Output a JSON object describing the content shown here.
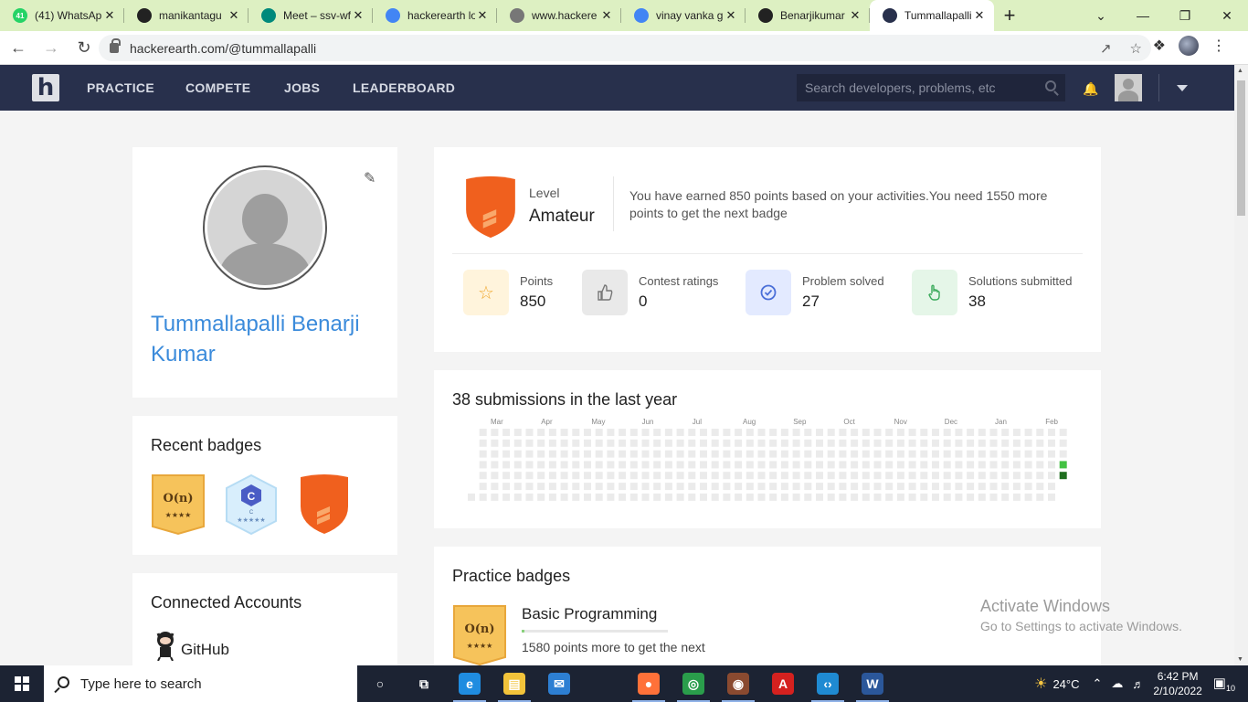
{
  "browser": {
    "tabs": [
      {
        "label": "(41) WhatsAp",
        "icon": "whatsapp-icon",
        "color": "#25d366",
        "badge": "41"
      },
      {
        "label": "manikantagu",
        "icon": "github-icon",
        "color": "#222222"
      },
      {
        "label": "Meet – ssv-wf",
        "icon": "meet-icon",
        "color": "#00897b"
      },
      {
        "label": "hackerearth lo",
        "icon": "google-icon",
        "color": "#4285f4"
      },
      {
        "label": "www.hackere",
        "icon": "globe-icon",
        "color": "#777777"
      },
      {
        "label": "vinay vanka g",
        "icon": "google-icon",
        "color": "#4285f4"
      },
      {
        "label": "Benarjikumar",
        "icon": "github-icon",
        "color": "#222222"
      },
      {
        "label": "Tummallapalli",
        "icon": "hackerearth-icon",
        "color": "#28304c"
      }
    ],
    "active_tab": 7,
    "url": "hackerearth.com/@tummallapalli"
  },
  "site": {
    "logo": "h",
    "nav": [
      "PRACTICE",
      "COMPETE",
      "JOBS",
      "LEADERBOARD"
    ],
    "search_placeholder": "Search developers, problems, etc"
  },
  "profile": {
    "name": "Tummallapalli Benarji Kumar",
    "recent_badges_title": "Recent badges",
    "badges": [
      {
        "type": "gold-complexity",
        "text": "O(n)",
        "stars": "★★★★"
      },
      {
        "type": "blue-c",
        "text": "C",
        "sub": "C",
        "stars": "★★★★★"
      },
      {
        "type": "orange-shield"
      }
    ],
    "connected_title": "Connected Accounts",
    "accounts": [
      {
        "name": "GitHub",
        "icon": "github-octocat-icon"
      }
    ]
  },
  "level": {
    "label": "Level",
    "name": "Amateur",
    "message": "You have earned 850 points based on your activities.You need 1550 more points to get the next badge",
    "stats": [
      {
        "label": "Points",
        "value": "850",
        "icon": "star-icon",
        "bg": "#fff4dc",
        "fg": "#f0a830"
      },
      {
        "label": "Contest ratings",
        "value": "0",
        "icon": "thumbs-up-icon",
        "bg": "#e9e9e9",
        "fg": "#777777"
      },
      {
        "label": "Problem solved",
        "value": "27",
        "icon": "check-circle-icon",
        "bg": "#e3eaff",
        "fg": "#4a6fd8"
      },
      {
        "label": "Solutions submitted",
        "value": "38",
        "icon": "hand-pointer-icon",
        "bg": "#e5f6e8",
        "fg": "#3aaa5a"
      }
    ]
  },
  "submissions": {
    "title": "38 submissions in the last year",
    "months": [
      "Mar",
      "Apr",
      "May",
      "Jun",
      "Jul",
      "Aug",
      "Sep",
      "Oct",
      "Nov",
      "Dec",
      "Jan",
      "Feb"
    ],
    "active_cells": [
      {
        "week": 51,
        "day": 3,
        "level": 1
      },
      {
        "week": 51,
        "day": 4,
        "level": 2
      }
    ],
    "colors": {
      "empty": "#ebebeb",
      "level1": "#43c243",
      "level2": "#1f6e1f"
    }
  },
  "practice": {
    "title": "Practice badges",
    "badge_name": "Basic Programming",
    "badge_text": "O(n)",
    "badge_stars": "★★★★",
    "progress_fraction": 0.02,
    "points_text": "1580 points more to get the next"
  },
  "watermark": {
    "line1": "Activate Windows",
    "line2": "Go to Settings to activate Windows."
  },
  "taskbar": {
    "search_placeholder": "Type here to search",
    "apps": [
      {
        "name": "cortana",
        "icon": "circle-icon",
        "color": "#ffffff"
      },
      {
        "name": "task-view",
        "icon": "task-view-icon",
        "color": "#ffffff"
      },
      {
        "name": "edge",
        "icon": "edge-icon",
        "color": "#1f8ce0"
      },
      {
        "name": "file-explorer",
        "icon": "folder-icon",
        "color": "#f2c33a"
      },
      {
        "name": "mail",
        "icon": "mail-icon",
        "color": "#2d7fd3"
      },
      {
        "name": "firefox",
        "icon": "firefox-icon",
        "color": "#ff7139"
      },
      {
        "name": "chrome",
        "icon": "chrome-icon",
        "color": "#2a9d4b"
      },
      {
        "name": "chrome-profile",
        "icon": "chrome-profile-icon",
        "color": "#8a4a30"
      },
      {
        "name": "acrobat",
        "icon": "acrobat-icon",
        "color": "#d5211f"
      },
      {
        "name": "vscode",
        "icon": "vscode-icon",
        "color": "#1f8ad2"
      },
      {
        "name": "word",
        "icon": "word-icon",
        "color": "#2b579a"
      }
    ],
    "weather": "24°C",
    "time": "6:42 PM",
    "date": "2/10/2022",
    "notifications": "10"
  }
}
